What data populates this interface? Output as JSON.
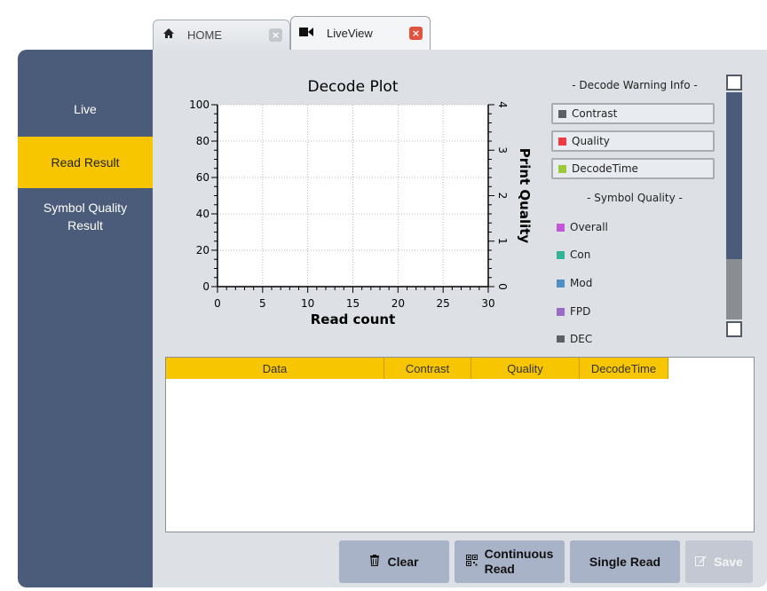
{
  "tabs": [
    {
      "label": "HOME",
      "icon": "home-icon",
      "close": "×"
    },
    {
      "label": "LiveView",
      "icon": "video-camera-icon",
      "close": "×"
    }
  ],
  "sidebar": {
    "items": [
      {
        "label": "Live"
      },
      {
        "label": "Read Result",
        "active": true
      },
      {
        "label": "Symbol Quality Result"
      }
    ]
  },
  "chart_data": {
    "type": "line",
    "title": "Decode Plot",
    "xlabel": "Read count",
    "ylabel": "",
    "y2label": "Print Quality",
    "xlim": [
      0,
      30
    ],
    "ylim": [
      0,
      100
    ],
    "y2lim": [
      0,
      4
    ],
    "x_ticks": [
      "0",
      "5",
      "10",
      "15",
      "20",
      "25",
      "30"
    ],
    "y_ticks": [
      "0",
      "20",
      "40",
      "60",
      "80",
      "100"
    ],
    "y2_ticks": [
      "0",
      "1",
      "2",
      "3",
      "4"
    ],
    "grid": true,
    "series": []
  },
  "legend": {
    "warning_heading": "- Decode Warning Info -",
    "warning_items": [
      {
        "label": "Contrast",
        "color": "#5a6066"
      },
      {
        "label": "Quality",
        "color": "#ef3a44"
      },
      {
        "label": "DecodeTime",
        "color": "#9cc93a"
      }
    ],
    "quality_heading": "- Symbol Quality -",
    "quality_items": [
      {
        "label": "Overall",
        "color": "#c355d8"
      },
      {
        "label": "Con",
        "color": "#34b497"
      },
      {
        "label": "Mod",
        "color": "#4e8fc6"
      },
      {
        "label": "FPD",
        "color": "#9c6bc4"
      },
      {
        "label": "DEC",
        "color": "#5a6066"
      }
    ]
  },
  "table": {
    "columns": [
      "Data",
      "Contrast",
      "Quality",
      "DecodeTime"
    ],
    "rows": []
  },
  "buttons": {
    "clear": "Clear",
    "continuous_line1": "Continuous",
    "continuous_line2": "Read",
    "single": "Single Read",
    "save": "Save"
  },
  "colors": {
    "sidebar": "#4b5c7a",
    "accent": "#f8c600",
    "panel": "#dde1e6",
    "button": "#a8b3c7"
  }
}
